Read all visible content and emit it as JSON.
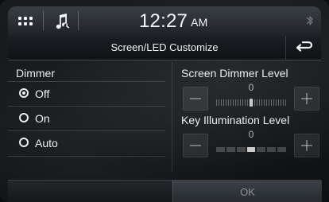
{
  "status_bar": {
    "time": "12:27",
    "ampm": "AM"
  },
  "title_bar": {
    "title": "Screen/LED Customize"
  },
  "dimmer": {
    "label": "Dimmer",
    "options": [
      {
        "label": "Off",
        "selected": true
      },
      {
        "label": "On",
        "selected": false
      },
      {
        "label": "Auto",
        "selected": false
      }
    ]
  },
  "screen_dimmer_level": {
    "label": "Screen Dimmer Level",
    "value": "0"
  },
  "key_illumination_level": {
    "label": "Key Illumination Level",
    "value": "0"
  },
  "footer": {
    "ok_label": "OK"
  },
  "icons": {
    "apps": "apps-grid-icon",
    "music": "music-note-icon",
    "bluetooth": "bluetooth-icon",
    "back": "back-arrow-icon"
  }
}
